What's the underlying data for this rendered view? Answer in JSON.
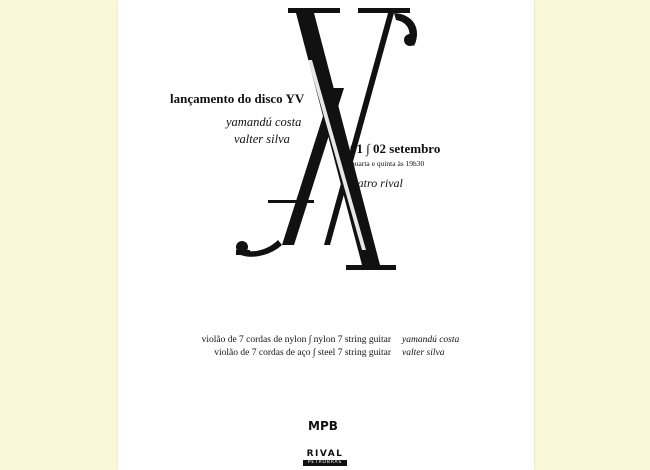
{
  "event": {
    "title": "lançamento do disco YV",
    "artists": [
      "yamandú costa",
      "valter silva"
    ],
    "date": "01 ∫ 02 setembro",
    "time": "quarta e quinta às 19h30",
    "venue": "teatro rival"
  },
  "credits": [
    {
      "instrument": "violão de 7 cordas de nylon ∫ nylon 7 string guitar",
      "musician": "yamandú costa"
    },
    {
      "instrument": "violão de 7 cordas de aço ∫ steel 7 string guitar",
      "musician": "valter silva"
    }
  ],
  "logos": {
    "mpb": "MPB",
    "rival_name": "RIVAL",
    "rival_sub": "PETROBRAS"
  },
  "colors": {
    "background": "#fbf8d8",
    "poster": "#ffffff",
    "ink": "#111111"
  }
}
